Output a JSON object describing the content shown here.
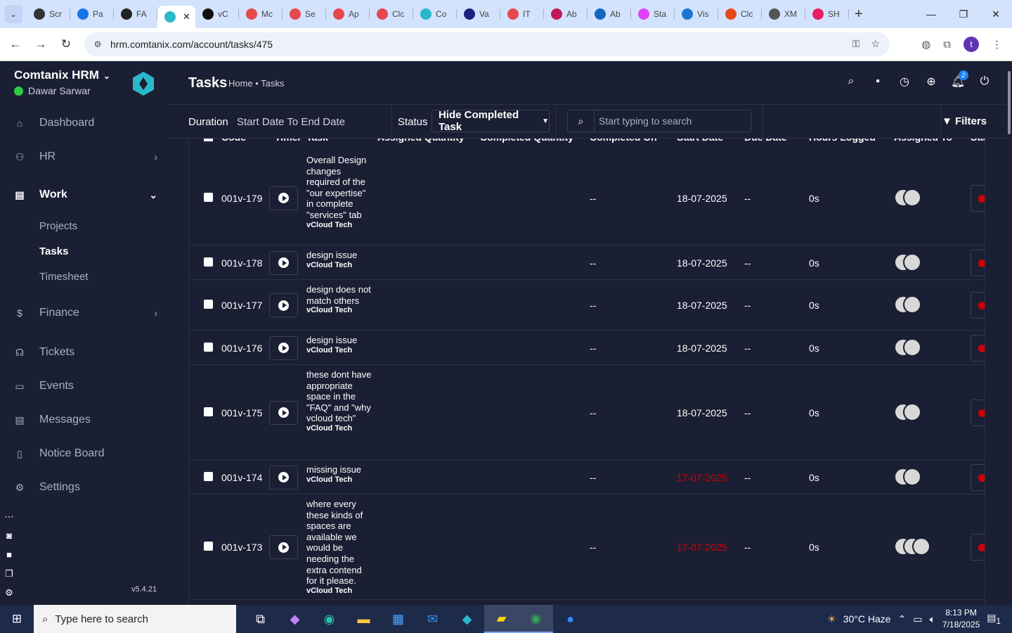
{
  "browser": {
    "tabs": [
      {
        "label": "Scr",
        "color": "#333333"
      },
      {
        "label": "Pa",
        "color": "#1a73e8"
      },
      {
        "label": "FA",
        "color": "#222222"
      },
      {
        "label": "",
        "color": "#2ab7ca",
        "active": true
      },
      {
        "label": "vC",
        "color": "#111111"
      },
      {
        "label": "Mc",
        "color": "#e5484d"
      },
      {
        "label": "Se",
        "color": "#e5484d"
      },
      {
        "label": "Ap",
        "color": "#e5484d"
      },
      {
        "label": "Clc",
        "color": "#e5484d"
      },
      {
        "label": "Co",
        "color": "#2ab7ca"
      },
      {
        "label": "Va",
        "color": "#1a237e"
      },
      {
        "label": "IT",
        "color": "#e5484d"
      },
      {
        "label": "Ab",
        "color": "#c2185b"
      },
      {
        "label": "Ab",
        "color": "#1565c0"
      },
      {
        "label": "Sta",
        "color": "#e040fb"
      },
      {
        "label": "Vis",
        "color": "#1976d2"
      },
      {
        "label": "Clc",
        "color": "#e64a19"
      },
      {
        "label": "XM",
        "color": "#555555"
      },
      {
        "label": "SH",
        "color": "#e91e63"
      }
    ],
    "url": "hrm.comtanix.com/account/tasks/475",
    "profile_initial": "t"
  },
  "sidebar": {
    "brand": "Comtanix HRM",
    "user": "Dawar Sarwar",
    "items": [
      {
        "label": "Dashboard",
        "icon": "home-icon",
        "glyph": "⌂"
      },
      {
        "label": "HR",
        "icon": "users-icon",
        "glyph": "⚇",
        "caret": "›"
      },
      {
        "label": "Work",
        "icon": "briefcase-icon",
        "glyph": "▤",
        "caret": "⌄"
      },
      {
        "label": "Finance",
        "icon": "dollar-icon",
        "glyph": "$",
        "caret": "›"
      },
      {
        "label": "Tickets",
        "icon": "headset-icon",
        "glyph": "☊"
      },
      {
        "label": "Events",
        "icon": "calendar-icon",
        "glyph": "▭"
      },
      {
        "label": "Messages",
        "icon": "message-icon",
        "glyph": "▤"
      },
      {
        "label": "Notice Board",
        "icon": "clipboard-icon",
        "glyph": "▯"
      },
      {
        "label": "Settings",
        "icon": "gear-icon",
        "glyph": "⚙"
      }
    ],
    "work_sub": [
      "Projects",
      "Tasks",
      "Timesheet"
    ],
    "version": "v5.4.21"
  },
  "header": {
    "title": "Tasks",
    "breadcrumb": "Home • Tasks",
    "notification_count": "2"
  },
  "filters": {
    "duration_label": "Duration",
    "date_range": "Start Date To End Date",
    "status_label": "Status",
    "status_value": "Hide Completed Task",
    "search_placeholder": "Start typing to search",
    "filters_button": "Filters"
  },
  "table": {
    "columns": [
      "Code",
      "Timer",
      "Task",
      "Assigned Quantity",
      "Completed Quantity",
      "Completed On",
      "Start Date",
      "Due Date",
      "Hours Logged",
      "Assigned To",
      "Sta"
    ],
    "rows": [
      {
        "code": "001v-179",
        "task": "Overall Design changes required of the \"our expertise\" in complete \"services\" tab",
        "project": "vCloud Tech",
        "completed_on": "--",
        "start_date": "18-07-2025",
        "overdue": false,
        "due_date": "--",
        "hours": "0s",
        "avatars": 2
      },
      {
        "code": "001v-178",
        "task": "design issue",
        "project": "vCloud Tech",
        "completed_on": "--",
        "start_date": "18-07-2025",
        "overdue": false,
        "due_date": "--",
        "hours": "0s",
        "avatars": 2
      },
      {
        "code": "001v-177",
        "task": "design does not match others",
        "project": "vCloud Tech",
        "completed_on": "--",
        "start_date": "18-07-2025",
        "overdue": false,
        "due_date": "--",
        "hours": "0s",
        "avatars": 2
      },
      {
        "code": "001v-176",
        "task": "design issue",
        "project": "vCloud Tech",
        "completed_on": "--",
        "start_date": "18-07-2025",
        "overdue": false,
        "due_date": "--",
        "hours": "0s",
        "avatars": 2
      },
      {
        "code": "001v-175",
        "task": "these dont have appropriate space in the \"FAQ\" and \"why vcloud tech\"",
        "project": "vCloud Tech",
        "completed_on": "--",
        "start_date": "18-07-2025",
        "overdue": false,
        "due_date": "--",
        "hours": "0s",
        "avatars": 2
      },
      {
        "code": "001v-174",
        "task": "missing issue",
        "project": "vCloud Tech",
        "completed_on": "--",
        "start_date": "17-07-2025",
        "overdue": true,
        "due_date": "--",
        "hours": "0s",
        "avatars": 2
      },
      {
        "code": "001v-173",
        "task": "where every these kinds of spaces are available we would be needing the extra contend for it please.",
        "project": "vCloud Tech",
        "completed_on": "--",
        "start_date": "17-07-2025",
        "overdue": true,
        "due_date": "--",
        "hours": "0s",
        "avatars": 3
      }
    ]
  },
  "taskbar": {
    "search_placeholder": "Type here to search",
    "weather": "30°C  Haze",
    "time": "8:13 PM",
    "date": "7/18/2025",
    "notification_count": "1"
  },
  "colors": {
    "background": "#1b1f33",
    "accent": "#1d82f5",
    "overdue": "#d30000",
    "online": "#2ecc40"
  }
}
